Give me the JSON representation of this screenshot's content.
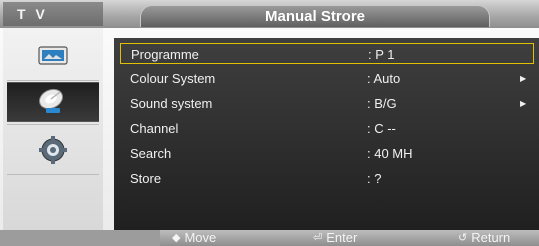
{
  "window": {
    "source_tab": "T V",
    "title": "Manual Strore"
  },
  "sidebar": {
    "items": [
      {
        "icon": "picture-icon"
      },
      {
        "icon": "satellite-dish-icon",
        "selected": true
      },
      {
        "icon": "gear-icon"
      }
    ]
  },
  "menu": {
    "rows": [
      {
        "label": "Programme",
        "value": ":  P     1",
        "arrow": ""
      },
      {
        "label": "Colour System",
        "value": ":  Auto",
        "arrow": "▶"
      },
      {
        "label": "Sound system",
        "value": ":  B/G",
        "arrow": "▶"
      },
      {
        "label": "Channel",
        "value": ":  C     --",
        "arrow": ""
      },
      {
        "label": "Search",
        "value": ":  40        MH",
        "arrow": ""
      },
      {
        "label": "Store",
        "value": ":  ?",
        "arrow": ""
      }
    ]
  },
  "footer": {
    "move_icon": "◆",
    "move_label": "Move",
    "enter_icon": "⏎",
    "enter_label": "Enter",
    "return_icon": "↺",
    "return_label": "Return"
  },
  "colors": {
    "highlight_border": "#e0c000",
    "panel_background": "#2a2a2a",
    "text": "#f0f0f0"
  }
}
